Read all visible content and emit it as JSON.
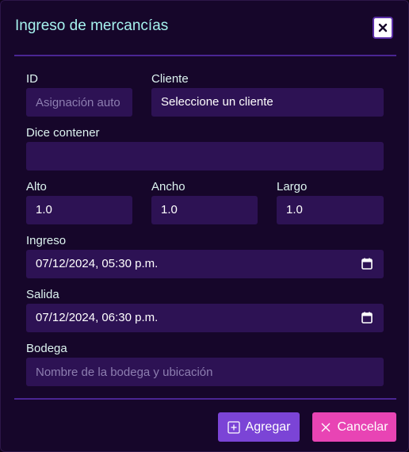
{
  "modal": {
    "title": "Ingreso de mercancías",
    "close_icon": "close-icon"
  },
  "form": {
    "id": {
      "label": "ID",
      "placeholder": "Asignación auto"
    },
    "cliente": {
      "label": "Cliente",
      "value": "Seleccione un cliente"
    },
    "dice_contener": {
      "label": "Dice contener",
      "value": ""
    },
    "alto": {
      "label": "Alto",
      "value": "1.0"
    },
    "ancho": {
      "label": "Ancho",
      "value": "1.0"
    },
    "largo": {
      "label": "Largo",
      "value": "1.0"
    },
    "ingreso": {
      "label": "Ingreso",
      "value": "07/12/2024, 05:30 p.m.",
      "icon": "calendar-icon"
    },
    "salida": {
      "label": "Salida",
      "value": "07/12/2024, 06:30 p.m.",
      "icon": "calendar-icon"
    },
    "bodega": {
      "label": "Bodega",
      "placeholder": "Nombre de la bodega y ubicación"
    }
  },
  "footer": {
    "add_label": "Agregar",
    "add_icon": "plus-square-icon",
    "cancel_label": "Cancelar",
    "cancel_icon": "close-icon"
  },
  "colors": {
    "background": "#16062a",
    "title": "#a6f3ef",
    "field": "#2d1254",
    "divider": "#4a2593",
    "add_button": "#7b44d6",
    "cancel_button": "#e844b4"
  }
}
